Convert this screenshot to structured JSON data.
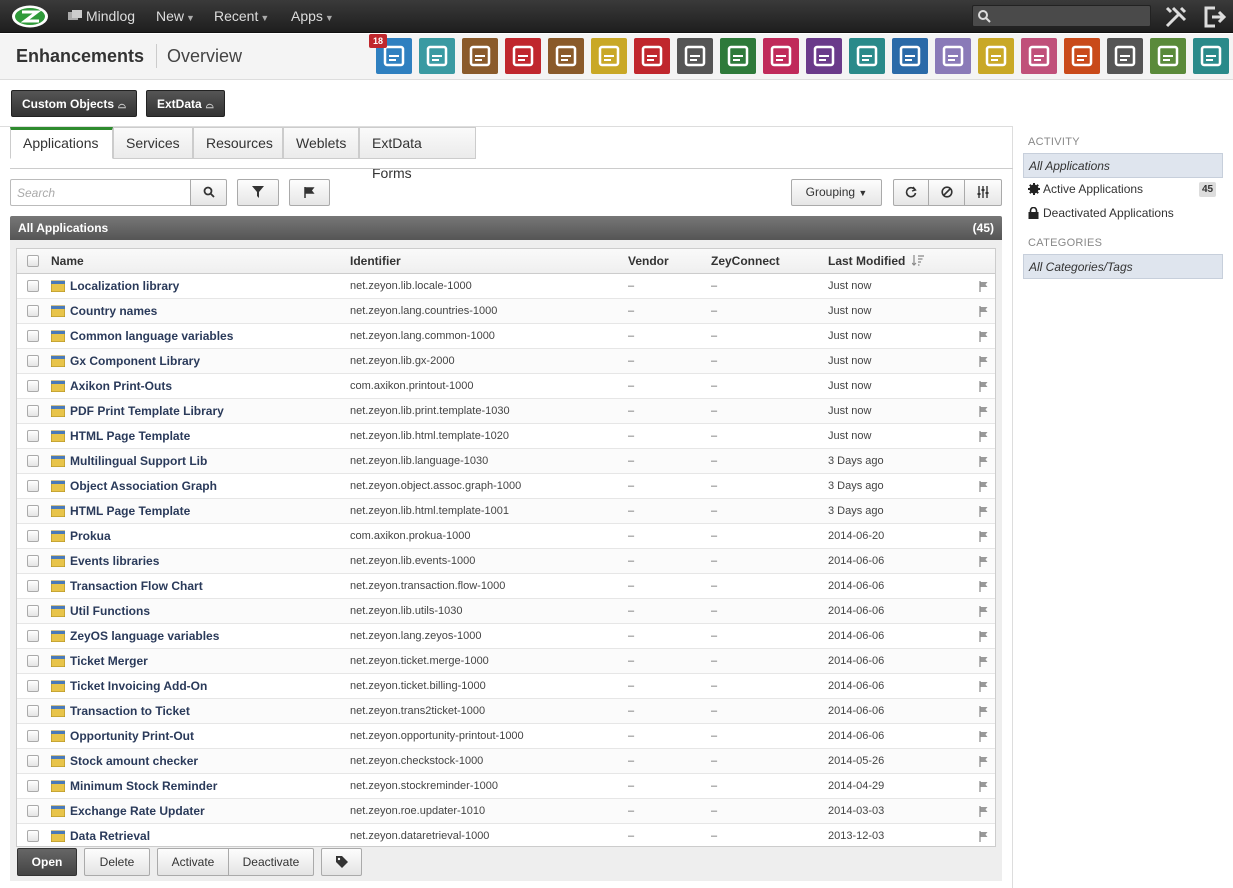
{
  "topbar": {
    "app_name": "Mindlog",
    "nav": [
      {
        "label": "New"
      },
      {
        "label": "Recent"
      },
      {
        "label": "Apps"
      }
    ],
    "search_placeholder": ""
  },
  "header": {
    "title": "Enhancements",
    "subtitle": "Overview",
    "mail_badge": "18",
    "app_icons": [
      {
        "name": "mail-icon",
        "color": "#2f80c0"
      },
      {
        "name": "contacts-at-icon",
        "color": "#3a9aa2"
      },
      {
        "name": "address-book-icon",
        "color": "#8a5a2a"
      },
      {
        "name": "calendar-icon",
        "color": "#c0272d"
      },
      {
        "name": "tasks-folder-icon",
        "color": "#8a5a2a"
      },
      {
        "name": "checklist-icon",
        "color": "#c9a826"
      },
      {
        "name": "stopwatch-icon",
        "color": "#c0272d"
      },
      {
        "name": "notes-edit-icon",
        "color": "#555555"
      },
      {
        "name": "bookmark-icon",
        "color": "#2e7a3a"
      },
      {
        "name": "cashdesk-icon",
        "color": "#c02a5a"
      },
      {
        "name": "dollar-icon",
        "color": "#6a3a8a"
      },
      {
        "name": "truck-icon",
        "color": "#2a8a8a"
      },
      {
        "name": "support-icon",
        "color": "#2a6aa8"
      },
      {
        "name": "documents-icon",
        "color": "#8a7ab8"
      },
      {
        "name": "contract-icon",
        "color": "#c9a826"
      },
      {
        "name": "handshake-icon",
        "color": "#c0507a"
      },
      {
        "name": "antenna-icon",
        "color": "#c94a1a"
      },
      {
        "name": "inventory-icon",
        "color": "#555555"
      },
      {
        "name": "price-tag-icon",
        "color": "#5a8a3a"
      },
      {
        "name": "lab-flask-icon",
        "color": "#2a8a8a"
      }
    ]
  },
  "subbuttons": {
    "custom_objects": "Custom Objects",
    "extdata": "ExtData"
  },
  "tabs": [
    "Applications",
    "Services",
    "Resources",
    "Weblets",
    "ExtData Forms"
  ],
  "toolbar": {
    "search_placeholder": "Search",
    "grouping": "Grouping"
  },
  "grid": {
    "title": "All Applications",
    "count": "(45)",
    "columns": {
      "name": "Name",
      "identifier": "Identifier",
      "vendor": "Vendor",
      "zeyconnect": "ZeyConnect",
      "last_modified": "Last Modified"
    },
    "rows": [
      {
        "name": "Localization library",
        "id": "net.zeyon.lib.locale-1000",
        "vendor": "–",
        "zc": "–",
        "mod": "Just now"
      },
      {
        "name": "Country names",
        "id": "net.zeyon.lang.countries-1000",
        "vendor": "–",
        "zc": "–",
        "mod": "Just now"
      },
      {
        "name": "Common language variables",
        "id": "net.zeyon.lang.common-1000",
        "vendor": "–",
        "zc": "–",
        "mod": "Just now"
      },
      {
        "name": "Gx Component Library",
        "id": "net.zeyon.lib.gx-2000",
        "vendor": "–",
        "zc": "–",
        "mod": "Just now"
      },
      {
        "name": "Axikon Print-Outs",
        "id": "com.axikon.printout-1000",
        "vendor": "–",
        "zc": "–",
        "mod": "Just now"
      },
      {
        "name": "PDF Print Template Library",
        "id": "net.zeyon.lib.print.template-1030",
        "vendor": "–",
        "zc": "–",
        "mod": "Just now"
      },
      {
        "name": "HTML Page Template",
        "id": "net.zeyon.lib.html.template-1020",
        "vendor": "–",
        "zc": "–",
        "mod": "Just now"
      },
      {
        "name": "Multilingual Support Lib",
        "id": "net.zeyon.lib.language-1030",
        "vendor": "–",
        "zc": "–",
        "mod": "3 Days ago"
      },
      {
        "name": "Object Association Graph",
        "id": "net.zeyon.object.assoc.graph-1000",
        "vendor": "–",
        "zc": "–",
        "mod": "3 Days ago"
      },
      {
        "name": "HTML Page Template",
        "id": "net.zeyon.lib.html.template-1001",
        "vendor": "–",
        "zc": "–",
        "mod": "3 Days ago"
      },
      {
        "name": "Prokua",
        "id": "com.axikon.prokua-1000",
        "vendor": "–",
        "zc": "–",
        "mod": "2014-06-20"
      },
      {
        "name": "Events libraries",
        "id": "net.zeyon.lib.events-1000",
        "vendor": "–",
        "zc": "–",
        "mod": "2014-06-06"
      },
      {
        "name": "Transaction Flow Chart",
        "id": "net.zeyon.transaction.flow-1000",
        "vendor": "–",
        "zc": "–",
        "mod": "2014-06-06"
      },
      {
        "name": "Util Functions",
        "id": "net.zeyon.lib.utils-1030",
        "vendor": "–",
        "zc": "–",
        "mod": "2014-06-06"
      },
      {
        "name": "ZeyOS language variables",
        "id": "net.zeyon.lang.zeyos-1000",
        "vendor": "–",
        "zc": "–",
        "mod": "2014-06-06"
      },
      {
        "name": "Ticket Merger",
        "id": "net.zeyon.ticket.merge-1000",
        "vendor": "–",
        "zc": "–",
        "mod": "2014-06-06"
      },
      {
        "name": "Ticket Invoicing Add-On",
        "id": "net.zeyon.ticket.billing-1000",
        "vendor": "–",
        "zc": "–",
        "mod": "2014-06-06"
      },
      {
        "name": "Transaction to Ticket",
        "id": "net.zeyon.trans2ticket-1000",
        "vendor": "–",
        "zc": "–",
        "mod": "2014-06-06"
      },
      {
        "name": "Opportunity Print-Out",
        "id": "net.zeyon.opportunity-printout-1000",
        "vendor": "–",
        "zc": "–",
        "mod": "2014-06-06"
      },
      {
        "name": "Stock amount checker",
        "id": "net.zeyon.checkstock-1000",
        "vendor": "–",
        "zc": "–",
        "mod": "2014-05-26"
      },
      {
        "name": "Minimum Stock Reminder",
        "id": "net.zeyon.stockreminder-1000",
        "vendor": "–",
        "zc": "–",
        "mod": "2014-04-29"
      },
      {
        "name": "Exchange Rate Updater",
        "id": "net.zeyon.roe.updater-1010",
        "vendor": "–",
        "zc": "–",
        "mod": "2014-03-03"
      },
      {
        "name": "Data Retrieval",
        "id": "net.zeyon.dataretrieval-1000",
        "vendor": "–",
        "zc": "–",
        "mod": "2013-12-03"
      }
    ]
  },
  "footer": {
    "open": "Open",
    "delete": "Delete",
    "activate": "Activate",
    "deactivate": "Deactivate"
  },
  "sidebar": {
    "activity_heading": "ACTIVITY",
    "all_applications": "All Applications",
    "active_applications": "Active Applications",
    "active_count": "45",
    "deactivated_applications": "Deactivated Applications",
    "categories_heading": "CATEGORIES",
    "all_categories": "All Categories/Tags"
  }
}
